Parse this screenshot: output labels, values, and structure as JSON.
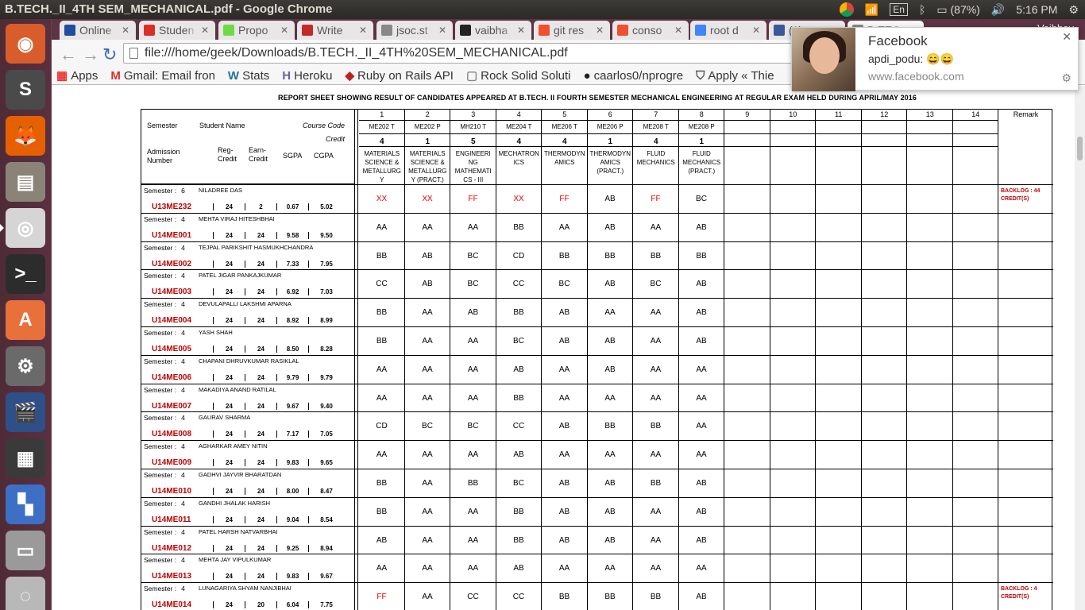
{
  "topbar": {
    "title": "B.TECH._II_4TH SEM_MECHANICAL.pdf - Google Chrome",
    "lang": "En",
    "battery": "(87%)",
    "time": "5:16 PM"
  },
  "tabs": [
    {
      "label": "Online",
      "icon": "paypal-icon",
      "color": "#1f4e9e"
    },
    {
      "label": "Studen",
      "icon": "gmail-icon",
      "color": "#d93025"
    },
    {
      "label": "Propo",
      "icon": "upwork-icon",
      "color": "#6fda44"
    },
    {
      "label": "Write",
      "icon": "ys-icon",
      "color": "#c62828"
    },
    {
      "label": "jsoc.st",
      "icon": "page-icon",
      "color": "#888888"
    },
    {
      "label": "vaibha",
      "icon": "github-icon",
      "color": "#222222"
    },
    {
      "label": "git res",
      "icon": "git-icon",
      "color": "#f05032"
    },
    {
      "label": "conso",
      "icon": "git-icon",
      "color": "#f05032"
    },
    {
      "label": "root d",
      "icon": "google-icon",
      "color": "#4285f4"
    },
    {
      "label": "(1) ",
      "icon": "facebook-icon",
      "color": "#3b5998"
    },
    {
      "label": "B.TEC",
      "icon": "pdf-icon",
      "color": "#888888"
    }
  ],
  "profile": "Vaibhav",
  "address": "file:///home/geek/Downloads/B.TECH._II_4TH%20SEM_MECHANICAL.pdf",
  "bookmarks": [
    {
      "label": "Apps",
      "icon": "apps-grid-icon"
    },
    {
      "label": "Gmail: Email fron",
      "icon": "gmail-icon"
    },
    {
      "label": "Stats",
      "icon": "wordpress-icon"
    },
    {
      "label": "Heroku",
      "icon": "heroku-icon"
    },
    {
      "label": "Ruby on Rails API",
      "icon": "ruby-icon"
    },
    {
      "label": "Rock Solid Soluti",
      "icon": "page-icon"
    },
    {
      "label": "caarlos0/nprogre",
      "icon": "github-icon"
    },
    {
      "label": "Apply « Thie",
      "icon": "shield-icon"
    }
  ],
  "notification": {
    "title": "Facebook",
    "body": "apdi_podu: 😄😄",
    "source": "www.facebook.com"
  },
  "report": {
    "title": "REPORT SHEET SHOWING RESULT OF CANDIDATES APPEARED AT  B.TECH. II FOURTH SEMESTER MECHANICAL ENGINEERING  AT REGULAR EXAM HELD DURING APRIL/MAY 2016",
    "hdr": {
      "semester": "Semester",
      "student_name": "Student Name",
      "course_code": "Course Code",
      "credit": "Credit",
      "admission": "Admission",
      "number": "Number",
      "reg": "Reg-",
      "reg2": "Credit",
      "earn": "Earn-",
      "earn2": "Credit",
      "sgpa": "SGPA",
      "cgpa": "CGPA"
    },
    "remark_header": "Remark",
    "columns": [
      {
        "num": "1",
        "code": "ME202 T",
        "credit": "4",
        "name": "MATERIALS SCIENCE & METALLURG Y"
      },
      {
        "num": "2",
        "code": "ME202 P",
        "credit": "1",
        "name": "MATERIALS SCIENCE & METALLURG Y (PRACT.)"
      },
      {
        "num": "3",
        "code": "MH210 T",
        "credit": "5",
        "name": "ENGINEERI NG MATHEMATI CS - III"
      },
      {
        "num": "4",
        "code": "ME204 T",
        "credit": "4",
        "name": "MECHATRON ICS"
      },
      {
        "num": "5",
        "code": "ME206 T",
        "credit": "4",
        "name": "THERMODYN AMICS"
      },
      {
        "num": "6",
        "code": "ME206 P",
        "credit": "1",
        "name": "THERMODYN AMICS (PRACT.)"
      },
      {
        "num": "7",
        "code": "ME208 T",
        "credit": "4",
        "name": "FLUID MECHANICS"
      },
      {
        "num": "8",
        "code": "ME208 P",
        "credit": "1",
        "name": "FLUID MECHANICS (PRACT.)"
      },
      {
        "num": "9",
        "code": "",
        "credit": "",
        "name": ""
      },
      {
        "num": "10",
        "code": "",
        "credit": "",
        "name": ""
      },
      {
        "num": "11",
        "code": "",
        "credit": "",
        "name": ""
      },
      {
        "num": "12",
        "code": "",
        "credit": "",
        "name": ""
      },
      {
        "num": "13",
        "code": "",
        "credit": "",
        "name": ""
      },
      {
        "num": "14",
        "code": "",
        "credit": "",
        "name": ""
      }
    ],
    "students": [
      {
        "sem": "Semester :",
        "semno": "6",
        "name": "NILADREE DAS",
        "roll": "U13ME232",
        "reg": "24",
        "earn": "2",
        "sgpa": "0.67",
        "cgpa": "5.02",
        "grades": [
          "XX",
          "XX",
          "FF",
          "XX",
          "FF",
          "AB",
          "FF",
          "BC"
        ],
        "remark": "BACKLOG : 44 CREDIT(S)"
      },
      {
        "sem": "Semester :",
        "semno": "4",
        "name": "MEHTA VIRAJ HITESHBHAI",
        "roll": "U14ME001",
        "reg": "24",
        "earn": "24",
        "sgpa": "9.58",
        "cgpa": "9.50",
        "grades": [
          "AA",
          "AA",
          "AA",
          "BB",
          "AA",
          "AB",
          "AA",
          "AB"
        ],
        "remark": ""
      },
      {
        "sem": "Semester :",
        "semno": "4",
        "name": "TEJPAL PARIKSHIT HASMUKHCHANDRA",
        "roll": "U14ME002",
        "reg": "24",
        "earn": "24",
        "sgpa": "7.33",
        "cgpa": "7.95",
        "grades": [
          "BB",
          "AB",
          "BC",
          "CD",
          "BB",
          "BB",
          "BB",
          "BB"
        ],
        "remark": ""
      },
      {
        "sem": "Semester :",
        "semno": "4",
        "name": "PATEL JIGAR PANKAJKUMAR",
        "roll": "U14ME003",
        "reg": "24",
        "earn": "24",
        "sgpa": "6.92",
        "cgpa": "7.03",
        "grades": [
          "CC",
          "AB",
          "BC",
          "CC",
          "BC",
          "AB",
          "BC",
          "AB"
        ],
        "remark": ""
      },
      {
        "sem": "Semester :",
        "semno": "4",
        "name": "DEVULAPALLI LAKSHMI APARNA",
        "roll": "U14ME004",
        "reg": "24",
        "earn": "24",
        "sgpa": "8.92",
        "cgpa": "8.99",
        "grades": [
          "BB",
          "AA",
          "AB",
          "BB",
          "AB",
          "AA",
          "AA",
          "AB"
        ],
        "remark": ""
      },
      {
        "sem": "Semester :",
        "semno": "4",
        "name": "YASH SHAH",
        "roll": "U14ME005",
        "reg": "24",
        "earn": "24",
        "sgpa": "8.50",
        "cgpa": "8.28",
        "grades": [
          "BB",
          "AA",
          "AA",
          "BC",
          "AB",
          "AB",
          "AA",
          "AB"
        ],
        "remark": ""
      },
      {
        "sem": "Semester :",
        "semno": "4",
        "name": "CHAPANI DHRUVKUMAR RASIKLAL",
        "roll": "U14ME006",
        "reg": "24",
        "earn": "24",
        "sgpa": "9.79",
        "cgpa": "9.79",
        "grades": [
          "AA",
          "AA",
          "AA",
          "AB",
          "AA",
          "AB",
          "AA",
          "AA"
        ],
        "remark": ""
      },
      {
        "sem": "Semester :",
        "semno": "4",
        "name": "MAKADIYA ANAND RATILAL",
        "roll": "U14ME007",
        "reg": "24",
        "earn": "24",
        "sgpa": "9.67",
        "cgpa": "9.40",
        "grades": [
          "AA",
          "AA",
          "AA",
          "BB",
          "AA",
          "AA",
          "AA",
          "AA"
        ],
        "remark": ""
      },
      {
        "sem": "Semester :",
        "semno": "4",
        "name": "GAURAV SHARMA",
        "roll": "U14ME008",
        "reg": "24",
        "earn": "24",
        "sgpa": "7.17",
        "cgpa": "7.05",
        "grades": [
          "CD",
          "BC",
          "BC",
          "CC",
          "AB",
          "BB",
          "BB",
          "AA"
        ],
        "remark": ""
      },
      {
        "sem": "Semester :",
        "semno": "4",
        "name": "AGHARKAR AMEY NITIN",
        "roll": "U14ME009",
        "reg": "24",
        "earn": "24",
        "sgpa": "9.83",
        "cgpa": "9.65",
        "grades": [
          "AA",
          "AA",
          "AA",
          "AB",
          "AA",
          "AA",
          "AA",
          "AA"
        ],
        "remark": ""
      },
      {
        "sem": "Semester :",
        "semno": "4",
        "name": "GADHVI JAYVIR BHARATDAN",
        "roll": "U14ME010",
        "reg": "24",
        "earn": "24",
        "sgpa": "8.00",
        "cgpa": "8.47",
        "grades": [
          "BB",
          "AA",
          "BB",
          "BC",
          "AB",
          "AB",
          "BB",
          "AB"
        ],
        "remark": ""
      },
      {
        "sem": "Semester :",
        "semno": "4",
        "name": "GANDHI JHALAK HARISH",
        "roll": "U14ME011",
        "reg": "24",
        "earn": "24",
        "sgpa": "9.04",
        "cgpa": "8.54",
        "grades": [
          "BB",
          "AA",
          "AA",
          "BB",
          "AB",
          "AB",
          "AA",
          "AB"
        ],
        "remark": ""
      },
      {
        "sem": "Semester :",
        "semno": "4",
        "name": "PATEL HARSH NATVARBHAI",
        "roll": "U14ME012",
        "reg": "24",
        "earn": "24",
        "sgpa": "9.25",
        "cgpa": "8.94",
        "grades": [
          "AB",
          "AA",
          "AA",
          "BB",
          "AB",
          "AB",
          "AA",
          "AB"
        ],
        "remark": ""
      },
      {
        "sem": "Semester :",
        "semno": "4",
        "name": "MEHTA JAY VIPULKUMAR",
        "roll": "U14ME013",
        "reg": "24",
        "earn": "24",
        "sgpa": "9.83",
        "cgpa": "9.67",
        "grades": [
          "AA",
          "AA",
          "AA",
          "AB",
          "AA",
          "AA",
          "AA",
          "AA"
        ],
        "remark": ""
      },
      {
        "sem": "Semester :",
        "semno": "4",
        "name": "LUNAGARIYA SHYAM NANJIBHAI",
        "roll": "U14ME014",
        "reg": "24",
        "earn": "20",
        "sgpa": "6.04",
        "cgpa": "7.75",
        "grades": [
          "FF",
          "AA",
          "CC",
          "CC",
          "BB",
          "BB",
          "BB",
          "AB"
        ],
        "remark": "BACKLOG : 4 CREDIT(S)"
      }
    ]
  },
  "launcher": [
    {
      "name": "dash-icon",
      "bg": "#d85d2b",
      "glyph": "◉"
    },
    {
      "name": "sublime-text-icon",
      "bg": "#4a4a4a",
      "glyph": "S"
    },
    {
      "name": "firefox-icon",
      "bg": "#e66000",
      "glyph": "🦊"
    },
    {
      "name": "files-icon",
      "bg": "#8a8478",
      "glyph": "▤"
    },
    {
      "name": "chrome-icon",
      "bg": "#d5d5d5",
      "glyph": "◎"
    },
    {
      "name": "terminal-icon",
      "bg": "#2c2c2c",
      "glyph": ">_"
    },
    {
      "name": "software-center-icon",
      "bg": "#e8703a",
      "glyph": "A"
    },
    {
      "name": "system-settings-icon",
      "bg": "#6a6a6a",
      "glyph": "⚙"
    },
    {
      "name": "video-editor-icon",
      "bg": "#2f4f88",
      "glyph": "🎬"
    },
    {
      "name": "calculator-icon",
      "bg": "#3a3a3a",
      "glyph": "▦"
    },
    {
      "name": "tetris-icon",
      "bg": "#3d6fc4",
      "glyph": "▚"
    },
    {
      "name": "disk-drive-icon",
      "bg": "#9a9a9a",
      "glyph": "▭"
    },
    {
      "name": "optical-drive-icon",
      "bg": "#b8b8b8",
      "glyph": "◌"
    }
  ]
}
